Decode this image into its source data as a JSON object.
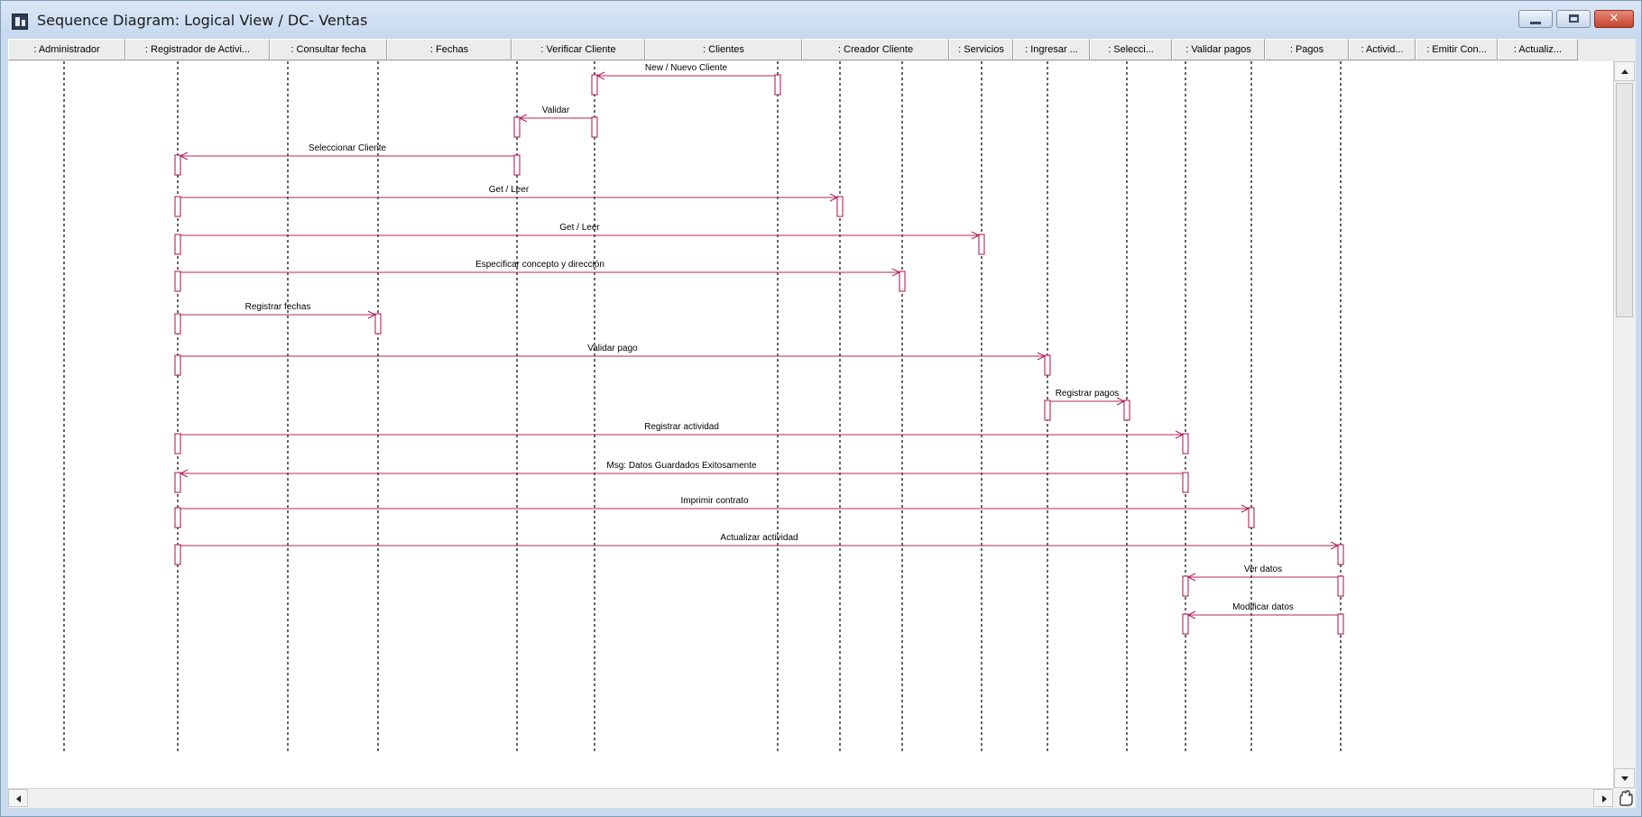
{
  "window": {
    "title": "Sequence Diagram: Logical View / DC- Ventas",
    "minimize_icon": "minimize-icon",
    "maximize_icon": "maximize-icon",
    "close_icon": "close-icon",
    "close_glyph": "✕"
  },
  "lifelines": [
    ": Administrador",
    ": Registrador de Activi...",
    ": Consultar fecha",
    ": Fechas",
    ": Verificar Cliente",
    ": Clientes",
    ": Creador Cliente",
    ": Servicios",
    ": Ingresar ...",
    ": Selecci...",
    ": Validar pagos",
    ": Pagos",
    ": Activid...",
    ": Emitir Con...",
    ": Actualiz..."
  ],
  "messages": [
    {
      "label": "New / Nuevo Cliente",
      "from": 6,
      "to": 5
    },
    {
      "label": "Validar",
      "from": 5,
      "to": 4
    },
    {
      "label": "Seleccionar Cliente",
      "from": 4,
      "to": 1
    },
    {
      "label": "Get / Leer",
      "from": 1,
      "to": 7
    },
    {
      "label": "Get / Leer",
      "from": 1,
      "to": 9
    },
    {
      "label": "Especificar concepto y dirección",
      "from": 1,
      "to": 8
    },
    {
      "label": "Registrar fechas",
      "from": 1,
      "to": 3
    },
    {
      "label": "Validar pago",
      "from": 1,
      "to": 10
    },
    {
      "label": "Registrar pagos",
      "from": 10,
      "to": 11
    },
    {
      "label": "Registrar actividad",
      "from": 1,
      "to": 12
    },
    {
      "label": "Msg: Datos Guardados Exitosamente",
      "from": 12,
      "to": 1
    },
    {
      "label": "Imprimir contrato",
      "from": 1,
      "to": 13
    },
    {
      "label": "Actualizar actividad",
      "from": 1,
      "to": 14
    },
    {
      "label": "Ver datos",
      "from": 14,
      "to": 12
    },
    {
      "label": "Modificar datos",
      "from": 14,
      "to": 12
    }
  ],
  "colors": {
    "message": "#b2245a",
    "lifeline": "#000000",
    "activation_fill": "#ffffff"
  },
  "scrollbars": {
    "up_icon": "scroll-up-arrow-icon",
    "down_icon": "scroll-down-arrow-icon",
    "left_icon": "scroll-left-arrow-icon",
    "right_icon": "scroll-right-arrow-icon",
    "hand_icon": "hand-pan-icon"
  }
}
